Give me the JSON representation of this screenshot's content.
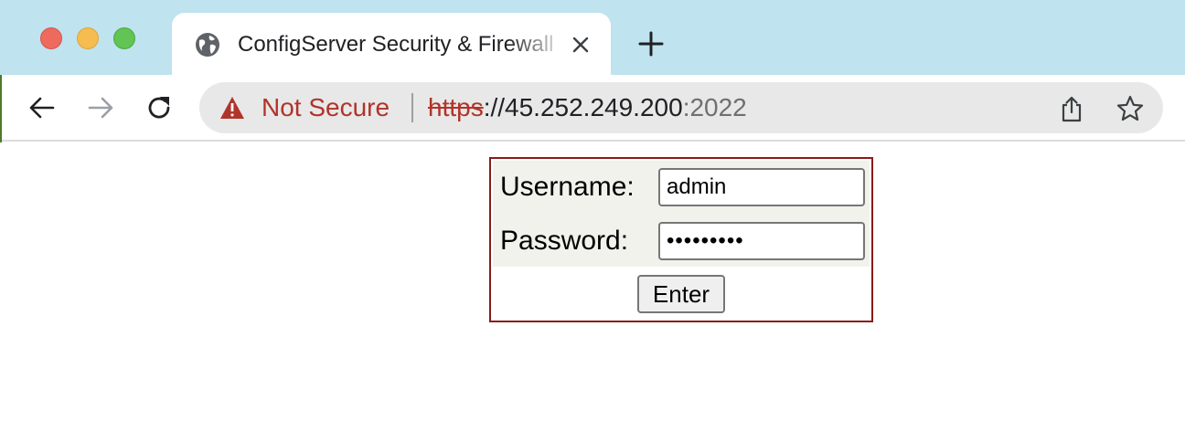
{
  "browser": {
    "tab": {
      "title": "ConfigServer Security & Firewall"
    },
    "address_bar": {
      "security_label": "Not Secure",
      "url_scheme": "https",
      "url_host": "://45.252.249.200",
      "url_port": ":2022"
    },
    "icons": {
      "tab_icon": "globe-icon",
      "close": "close-icon",
      "new_tab": "plus-icon",
      "back": "arrow-left-icon",
      "forward": "arrow-right-icon",
      "reload": "reload-icon",
      "warning": "warning-triangle-icon",
      "share": "share-icon",
      "bookmark": "star-icon"
    },
    "colors": {
      "tabstrip": "#bfe3ef",
      "warning": "#b0342a",
      "login_border": "#8b1a1a",
      "form_background": "#f2f2ec"
    }
  },
  "login": {
    "username_label": "Username:",
    "username_value": "admin",
    "password_label": "Password:",
    "password_value": "•••••••••",
    "enter_label": "Enter"
  }
}
